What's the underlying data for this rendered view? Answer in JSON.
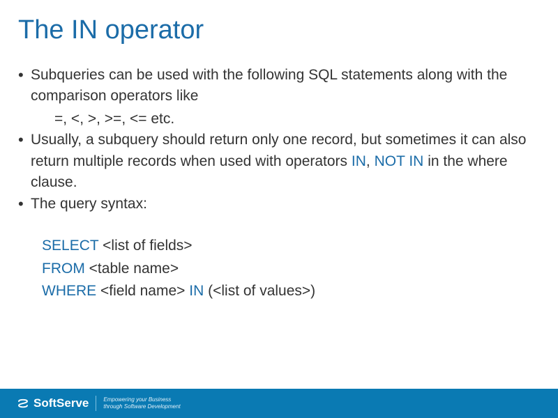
{
  "title": "The IN operator",
  "bullets": {
    "b1_prefix": "Subqueries can be used with the following SQL statements along with the comparison operators like",
    "b1_sub": "=, <, >, >=, <= etc.",
    "b2_p1": "Usually, a subquery should return only one record, but sometimes it can also return multiple records when used with operators ",
    "b2_kw1": "IN",
    "b2_sep": ", ",
    "b2_kw2": "NOT IN",
    "b2_p2": " in the where clause.",
    "b3": "The query syntax:"
  },
  "syntax": {
    "select_kw": "SELECT",
    "select_rest": " <list of fields>",
    "from_kw": "FROM",
    "from_rest": " <table name>",
    "where_kw": "WHERE",
    "where_mid": " <field name> ",
    "in_kw": "IN",
    "where_rest": " (<list of values>)"
  },
  "footer": {
    "brand": "SoftServe",
    "tag1": "Empowering your Business",
    "tag2": "through Software Development"
  }
}
